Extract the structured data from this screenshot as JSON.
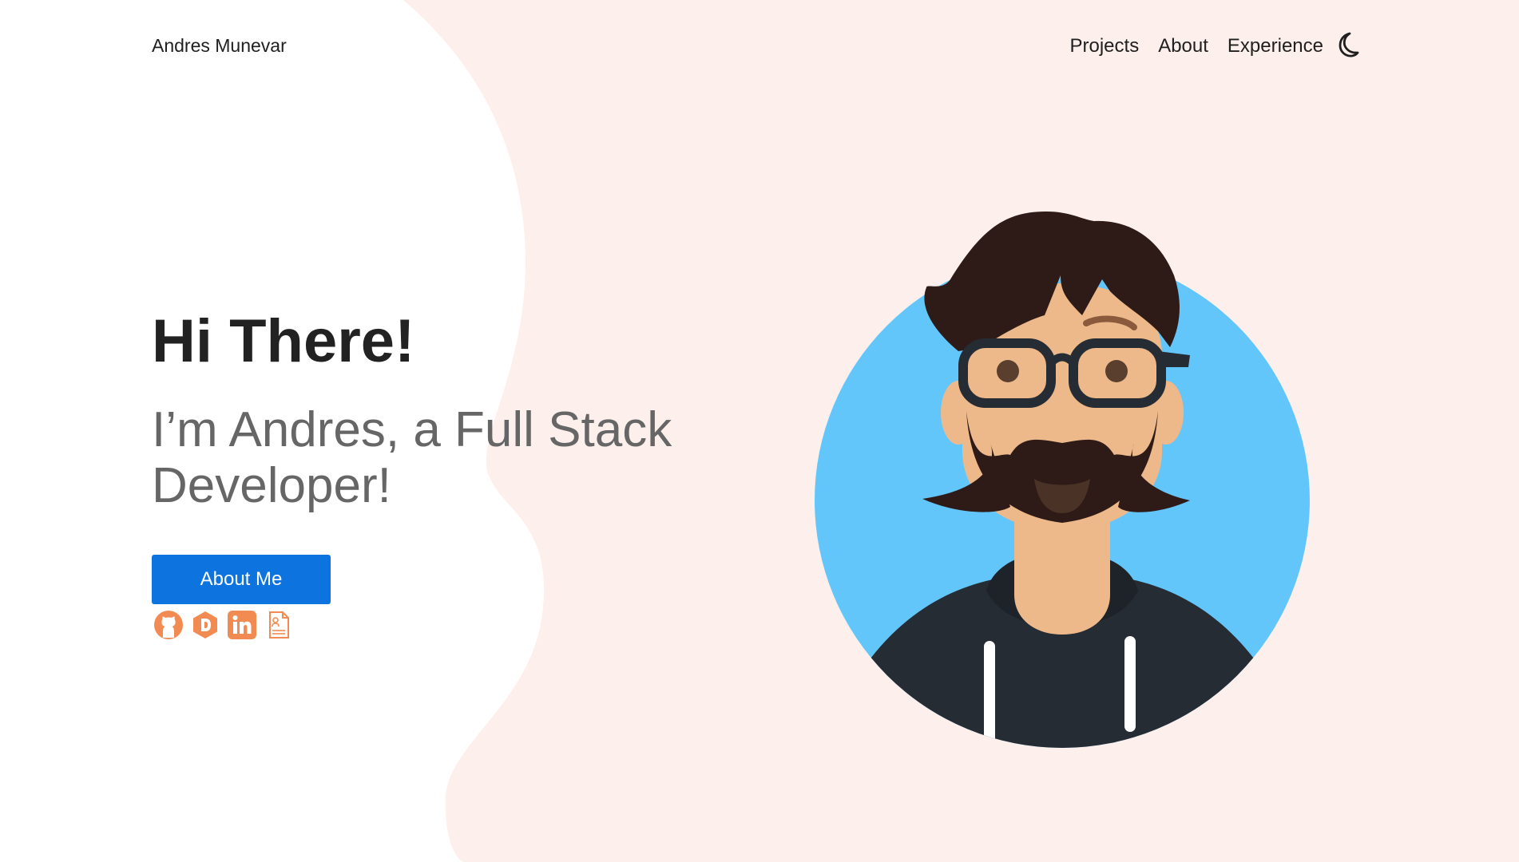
{
  "navbar": {
    "brand": "Andres Munevar",
    "links": [
      {
        "label": "Projects"
      },
      {
        "label": "About"
      },
      {
        "label": "Experience"
      }
    ],
    "theme_toggle_icon": "moon-icon"
  },
  "hero": {
    "title": "Hi There!",
    "subtitle": "I’m Andres, a Full Stack Developer!",
    "button_label": "About Me"
  },
  "social": [
    {
      "icon": "github-icon"
    },
    {
      "icon": "devto-icon"
    },
    {
      "icon": "linkedin-icon"
    },
    {
      "icon": "resume-icon"
    }
  ],
  "colors": {
    "accent": "#0d73de",
    "background_blob": "#fdf0ec",
    "social_icon": "#f28b52",
    "avatar_circle": "#63c6fb"
  }
}
